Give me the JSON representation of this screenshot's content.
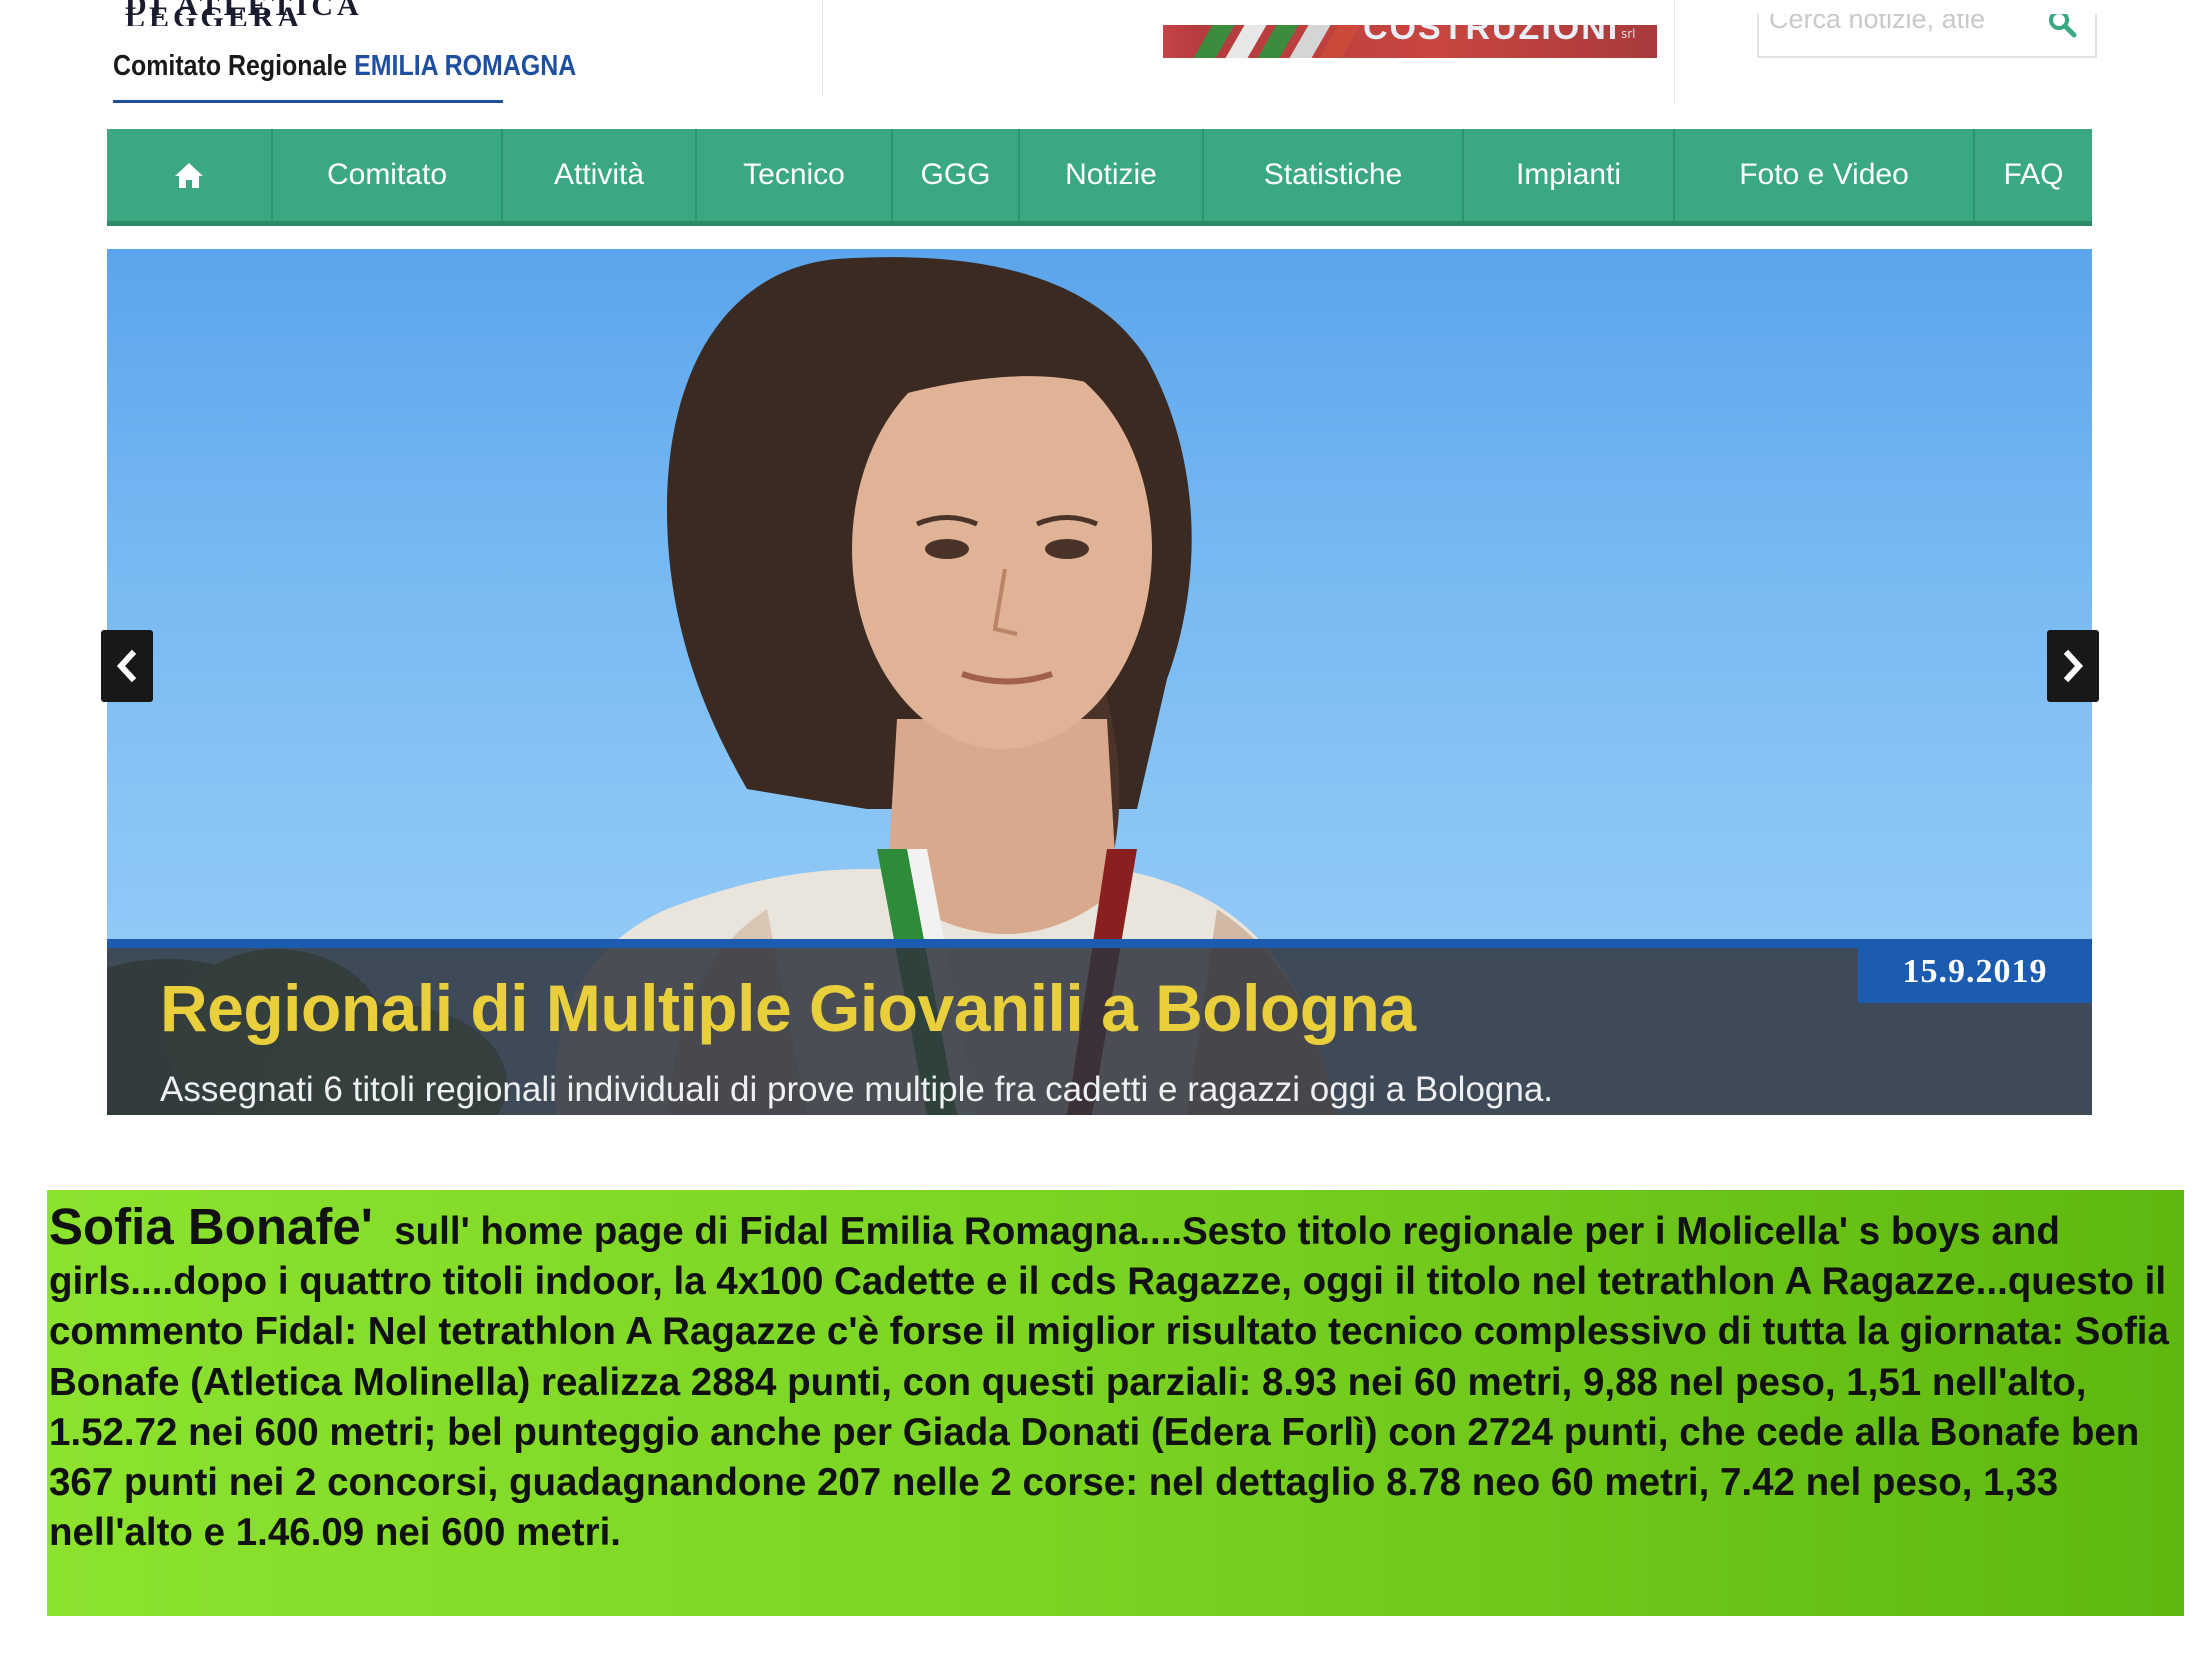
{
  "header": {
    "logo_top": "DI ATLETICA LEGGERA",
    "logo_org": "Comitato Regionale",
    "logo_region": "EMILIA ROMAGNA",
    "ad_text": "COSTRUZIONI",
    "search_placeholder": "Cerca notizie, atle"
  },
  "nav": {
    "home_icon": "home-icon",
    "items": [
      "Comitato",
      "Attività",
      "Tecnico",
      "GGG",
      "Notizie",
      "Statistiche",
      "Impianti",
      "Foto e Video",
      "FAQ"
    ]
  },
  "hero": {
    "title": "Regionali di Multiple Giovanili a Bologna",
    "subtitle": "Assegnati 6 titoli regionali individuali di prove multiple fra cadetti e ragazzi oggi a Bologna.",
    "date": "15.9.2019",
    "prev_icon": "chevron-left-icon",
    "next_icon": "chevron-right-icon"
  },
  "note": {
    "name": "Sofia Bonafe'",
    "text": "sull' home page di Fidal Emilia Romagna....Sesto titolo regionale per i Molicella' s boys and girls....dopo i quattro titoli indoor, la 4x100 Cadette e il cds Ragazze, oggi il titolo nel tetrathlon A Ragazze...questo il commento Fidal:  Nel tetrathlon A Ragazze c'è forse il miglior risultato tecnico complessivo di tutta la giornata: Sofia Bonafe (Atletica Molinella) realizza 2884 punti, con questi parziali: 8.93 nei 60 metri, 9,88 nel peso, 1,51 nell'alto, 1.52.72 nei 600 metri; bel punteggio anche per Giada Donati (Edera Forlì) con 2724 punti, che cede alla Bonafe ben 367 punti nei 2 concorsi, guadagnandone 207 nelle 2 corse: nel dettaglio 8.78 neo 60 metri, 7.42 nel peso, 1,33 nell'alto e 1.46.09 nei 600 metri."
  },
  "colors": {
    "nav_green": "#3aa981",
    "caption_blue": "#1b5bb0",
    "title_yellow": "#e9cf3c",
    "note_green": "#7cd423"
  }
}
